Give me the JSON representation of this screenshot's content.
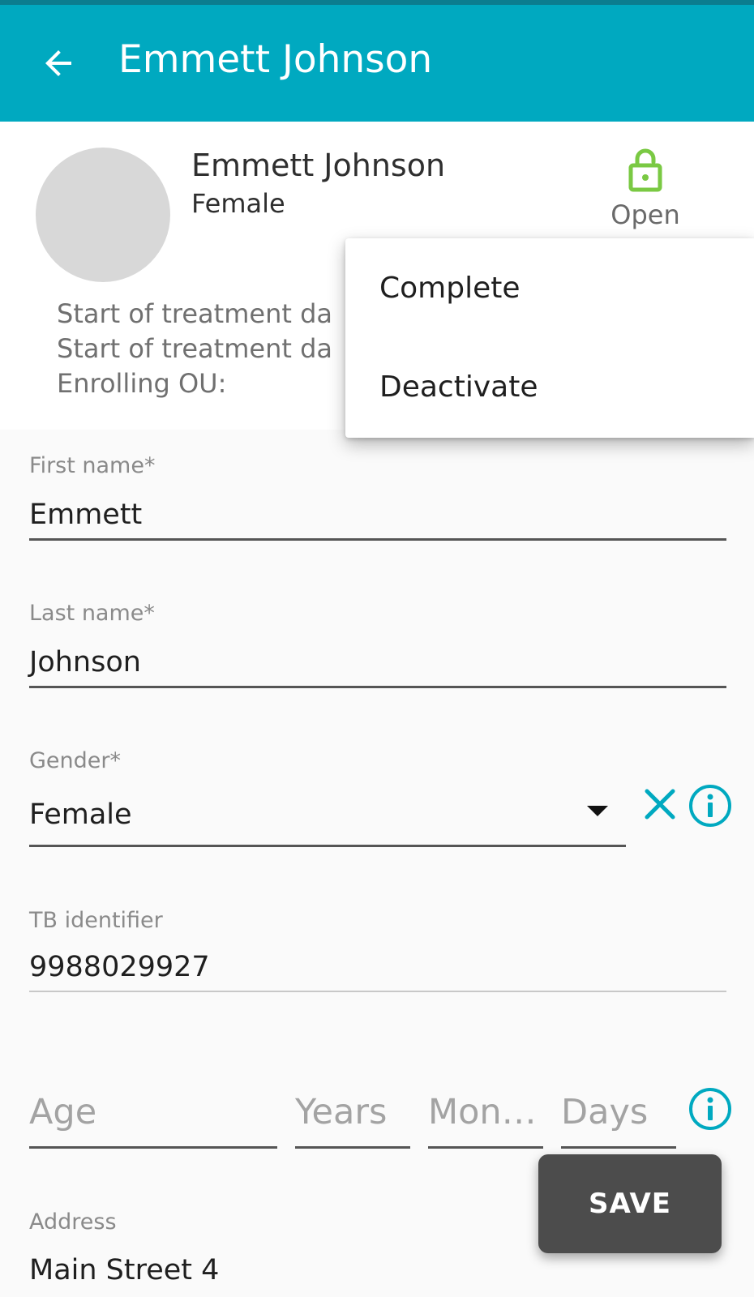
{
  "appbar": {
    "title": "Emmett Johnson"
  },
  "header": {
    "name": "Emmett Johnson",
    "gender": "Female",
    "status_label": "Open",
    "info_lines": [
      "Start of treatment da",
      "Start of treatment da",
      "Enrolling OU:"
    ]
  },
  "menu": {
    "items": [
      "Complete",
      "Deactivate"
    ]
  },
  "form": {
    "first_name": {
      "label": "First name*",
      "value": "Emmett"
    },
    "last_name": {
      "label": "Last name*",
      "value": "Johnson"
    },
    "gender": {
      "label": "Gender*",
      "value": "Female"
    },
    "tb_identifier": {
      "label": "TB identifier",
      "value": "9988029927"
    },
    "age": {
      "age_placeholder": "Age",
      "years_placeholder": "Years",
      "months_placeholder": "Mont...",
      "days_placeholder": "Days"
    },
    "address": {
      "label": "Address",
      "value": "Main Street 4"
    }
  },
  "save_button": {
    "label": "SAVE"
  },
  "colors": {
    "appbar": "#00a9c0",
    "accent": "#00a9c0",
    "lock_open": "#7ac943",
    "save_bg": "#4c4c4c"
  },
  "icons": {
    "back": "arrow-left-icon",
    "status": "lock-open-icon",
    "clear": "close-icon",
    "info": "info-circle-icon"
  }
}
